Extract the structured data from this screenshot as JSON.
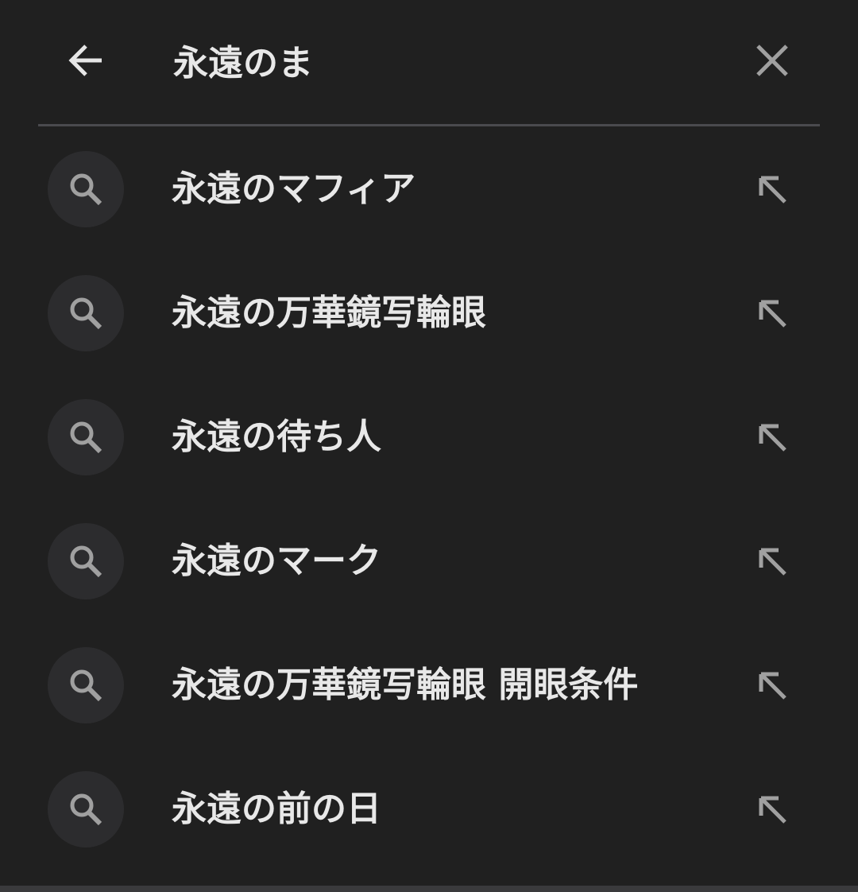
{
  "search": {
    "query": "永遠のま",
    "back_icon": "arrow-left-icon",
    "clear_icon": "close-icon"
  },
  "suggestions": [
    {
      "text": "永遠のマフィア",
      "icon": "search-icon",
      "action_icon": "arrow-up-left-icon"
    },
    {
      "text": "永遠の万華鏡写輪眼",
      "icon": "search-icon",
      "action_icon": "arrow-up-left-icon"
    },
    {
      "text": "永遠の待ち人",
      "icon": "search-icon",
      "action_icon": "arrow-up-left-icon"
    },
    {
      "text": "永遠のマーク",
      "icon": "search-icon",
      "action_icon": "arrow-up-left-icon"
    },
    {
      "text": "永遠の万華鏡写輪眼 開眼条件",
      "icon": "search-icon",
      "action_icon": "arrow-up-left-icon"
    },
    {
      "text": "永遠の前の日",
      "icon": "search-icon",
      "action_icon": "arrow-up-left-icon"
    }
  ],
  "colors": {
    "background": "#202020",
    "text": "#e8e8e8",
    "icon": "#a0a0a0",
    "icon_circle": "#2c2c2e",
    "divider": "#4a4a4e"
  }
}
